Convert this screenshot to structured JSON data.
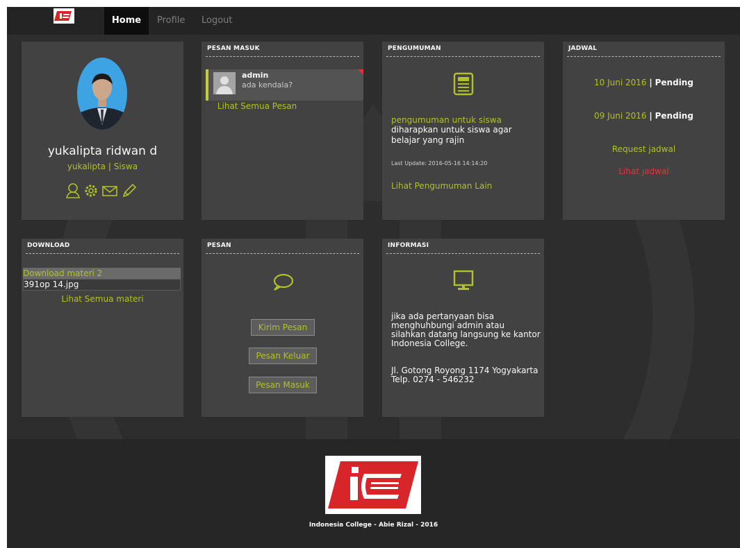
{
  "nav": {
    "items": [
      "Home",
      "Profile",
      "Logout"
    ]
  },
  "profile": {
    "name": "yukalipta ridwan d",
    "username": "yukalipta",
    "separator": "|",
    "role": "Siswa"
  },
  "inbox": {
    "title": "PESAN MASUK",
    "message": {
      "sender": "admin",
      "preview": "ada kendala?"
    },
    "link": "Lihat Semua Pesan"
  },
  "announcement": {
    "title": "PENGUMUMAN",
    "headline": "pengumuman untuk siswa",
    "body": "diharapkan untuk siswa agar belajar yang rajin",
    "last_update": "Last Update: 2016-05-16 14:14:20",
    "link": "Lihat Pengumuman Lain"
  },
  "schedule": {
    "title": "JADWAL",
    "entries": [
      {
        "date": "10 Juni 2016",
        "status": "Pending"
      },
      {
        "date": "09 Juni 2016",
        "status": "Pending"
      }
    ],
    "separator": "|",
    "request": "Request jadwal",
    "view": "Lihat jadwal"
  },
  "download": {
    "title": "DOWNLOAD",
    "items": [
      "Download materi 2",
      "391op 14.jpg"
    ],
    "link": "Lihat Semua materi"
  },
  "message": {
    "title": "PESAN",
    "buttons": [
      "Kirim Pesan",
      "Pesan Keluar",
      "Pesan Masuk"
    ]
  },
  "info": {
    "title": "INFORMASI",
    "body": "jika ada pertanyaan bisa menghuhbungi admin atau silahkan datang langsung ke kantor Indonesia College.",
    "address": "Jl. Gotong Royong 1174 Yogyakarta",
    "phone": "Telp. 0274 - 546232"
  },
  "footer": {
    "text": "Indonesia College - Abie Rizal - 2016"
  },
  "colors": {
    "accent": "#b5c727",
    "danger": "#e03a3a",
    "panel": "#434343",
    "background": "#2d2d2d"
  },
  "icons": [
    "user-icon",
    "gear-icon",
    "mail-icon",
    "pencil-icon",
    "newspaper-icon",
    "chat-bubble-icon",
    "monitor-icon"
  ]
}
